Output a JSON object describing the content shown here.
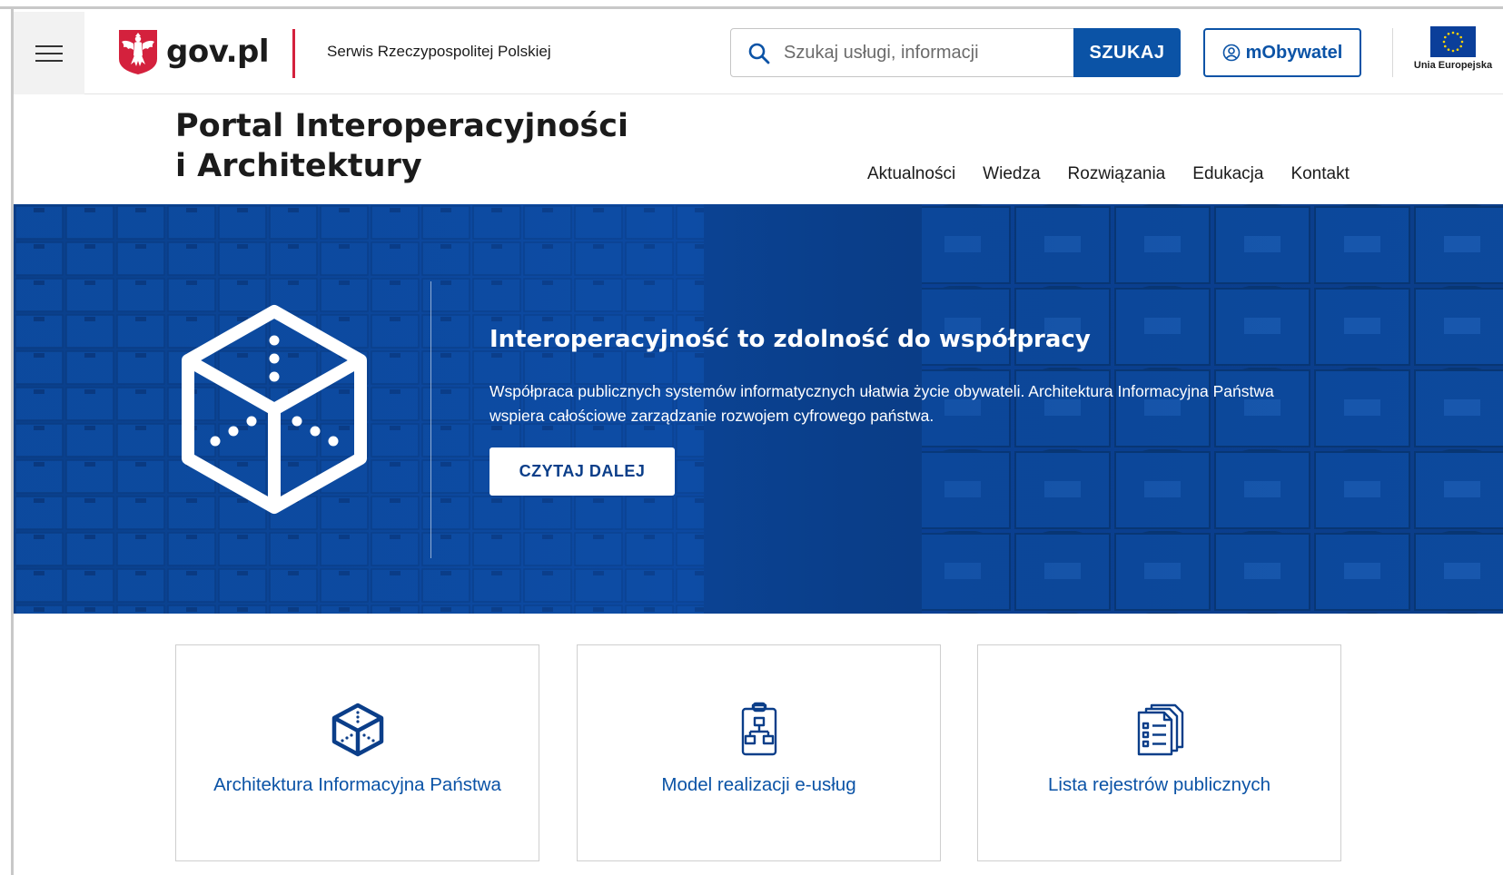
{
  "header": {
    "menu_icon": "hamburger-menu-icon",
    "logo_text": "gov.pl",
    "service_name": "Serwis Rzeczypospolitej Polskiej",
    "search": {
      "placeholder": "Szukaj usługi, informacji",
      "button_label": "SZUKAJ"
    },
    "mobywatel_label": "mObywatel",
    "eu_label": "Unia Europejska"
  },
  "portal": {
    "title_line1": "Portal Interoperacyjności",
    "title_line2": "i Architektury"
  },
  "nav": {
    "items": [
      {
        "label": "Aktualności"
      },
      {
        "label": "Wiedza"
      },
      {
        "label": "Rozwiązania"
      },
      {
        "label": "Edukacja"
      },
      {
        "label": "Kontakt"
      }
    ]
  },
  "hero": {
    "heading": "Interoperacyjność to zdolność do współpracy",
    "text": "Współpraca publicznych systemów informatycznych ułatwia życie obywateli. Architektura Informacyjna Państwa wspiera całościowe zarządzanie rozwojem cyfrowego państwa.",
    "button_label": "CZYTAJ DALEJ"
  },
  "cards": [
    {
      "label": "Architektura Informacyjna Państwa",
      "icon": "cube-icon"
    },
    {
      "label": "Model realizacji e-usług",
      "icon": "clipboard-diagram-icon"
    },
    {
      "label": "Lista rejestrów publicznych",
      "icon": "documents-list-icon"
    }
  ],
  "colors": {
    "primary": "#0b53a6",
    "hero_bg": "#0c4aa3",
    "accent_red": "#d4213d"
  }
}
